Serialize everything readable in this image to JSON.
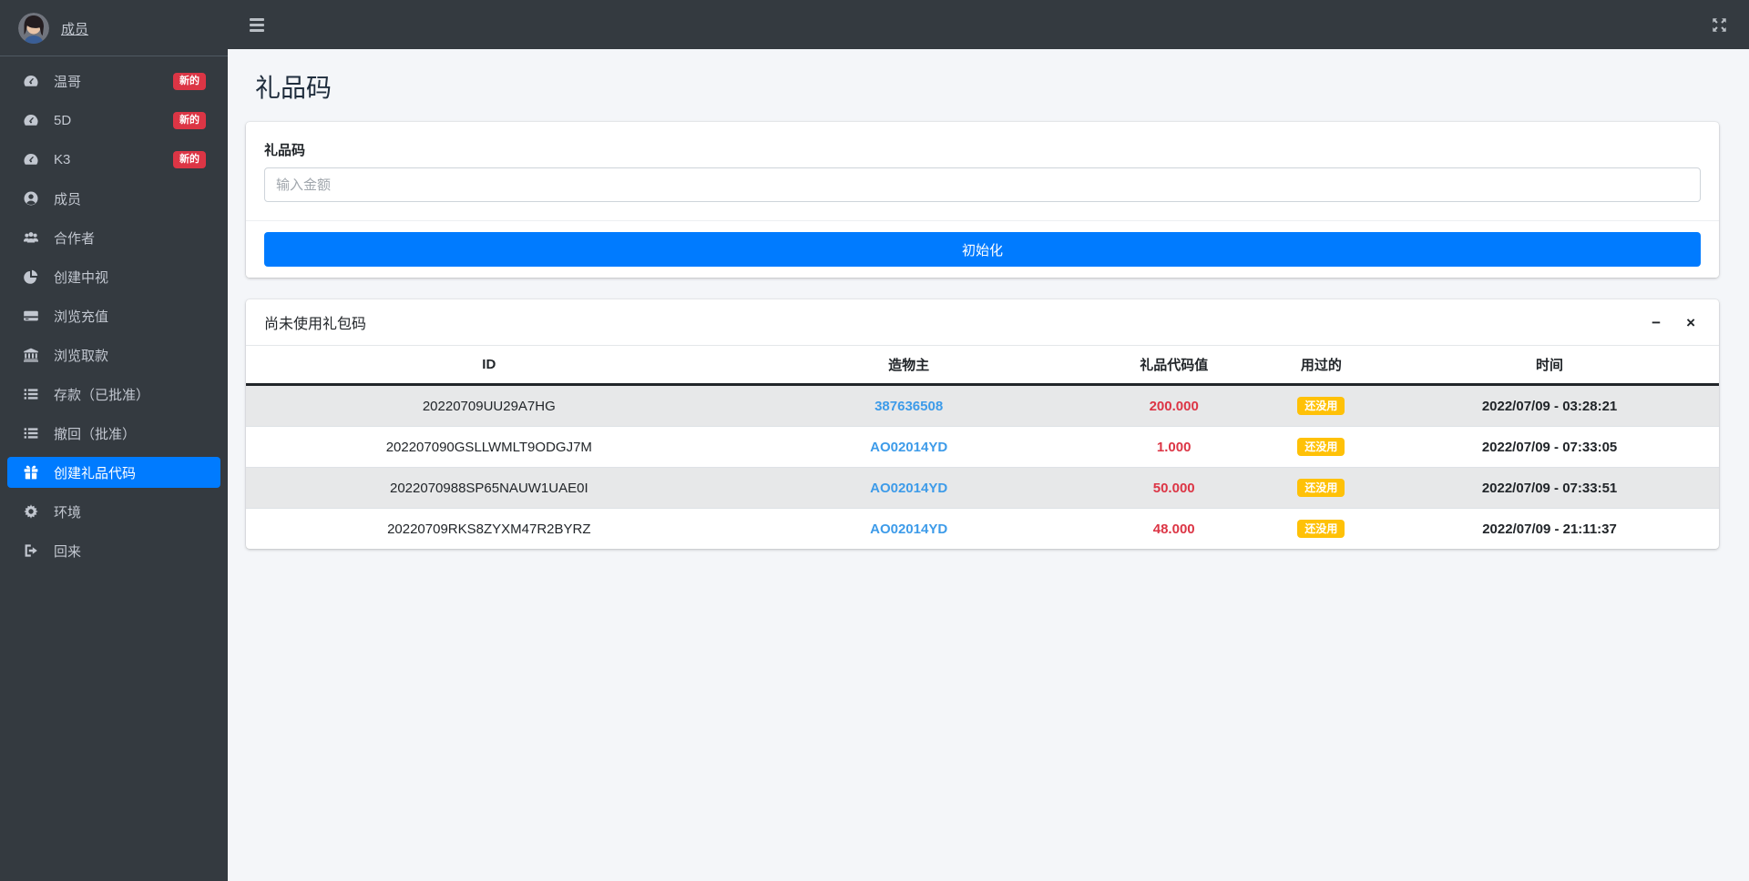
{
  "sidebar": {
    "user": {
      "name": "成员"
    },
    "items": [
      {
        "label": "温哥",
        "icon": "tachometer-icon",
        "badge": "新的"
      },
      {
        "label": "5D",
        "icon": "tachometer-icon",
        "badge": "新的"
      },
      {
        "label": "K3",
        "icon": "tachometer-icon",
        "badge": "新的"
      },
      {
        "label": "成员",
        "icon": "user-icon"
      },
      {
        "label": "合作者",
        "icon": "users-icon"
      },
      {
        "label": "创建中视",
        "icon": "pie-chart-icon"
      },
      {
        "label": "浏览充值",
        "icon": "credit-card-icon"
      },
      {
        "label": "浏览取款",
        "icon": "bank-icon"
      },
      {
        "label": "存款（已批准）",
        "icon": "list-icon"
      },
      {
        "label": "撤回（批准）",
        "icon": "list-icon"
      },
      {
        "label": "创建礼品代码",
        "icon": "gift-icon",
        "active": true
      },
      {
        "label": "环境",
        "icon": "gear-icon"
      },
      {
        "label": "回来",
        "icon": "sign-out-icon"
      }
    ]
  },
  "topbar": {
    "hamburger_icon": "menu-icon",
    "fullscreen_icon": "expand-arrows-icon"
  },
  "page": {
    "title": "礼品码"
  },
  "form_card": {
    "label": "礼品码",
    "input_value": "",
    "input_placeholder": "输入金额",
    "submit_label": "初始化"
  },
  "table_card": {
    "title": "尚未使用礼包码",
    "tools": {
      "collapse_label": "−",
      "close_label": "×"
    },
    "columns": [
      "ID",
      "造物主",
      "礼品代码值",
      "用过的",
      "时间"
    ],
    "rows": [
      {
        "id": "20220709UU29A7HG",
        "creator": "387636508",
        "value": "200.000",
        "used": "还没用",
        "time": "2022/07/09 - 03:28:21"
      },
      {
        "id": "202207090GSLLWMLT9ODGJ7M",
        "creator": "AO02014YD",
        "value": "1.000",
        "used": "还没用",
        "time": "2022/07/09 - 07:33:05"
      },
      {
        "id": "2022070988SP65NAUW1UAE0I",
        "creator": "AO02014YD",
        "value": "50.000",
        "used": "还没用",
        "time": "2022/07/09 - 07:33:51"
      },
      {
        "id": "20220709RKS8ZYXM47R2BYRZ",
        "creator": "AO02014YD",
        "value": "48.000",
        "used": "还没用",
        "time": "2022/07/09 - 21:11:37"
      }
    ]
  },
  "colors": {
    "sidebar_bg": "#343a40",
    "accent_blue": "#007bff",
    "danger_red": "#dc3545",
    "warning_yellow": "#ffc107",
    "link_blue": "#3d9be9",
    "content_bg": "#f4f6f9"
  }
}
